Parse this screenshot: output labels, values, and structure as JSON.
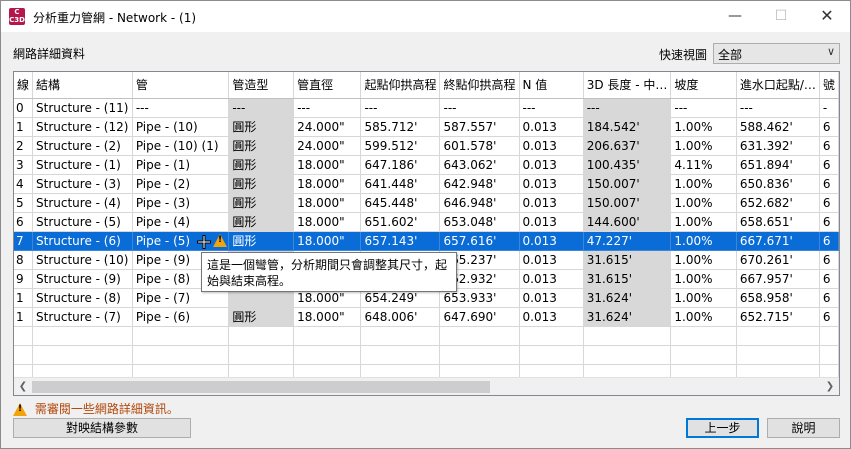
{
  "window": {
    "title": "分析重力管網 - Network - (1)",
    "icon_text_top": "C",
    "icon_text_bottom": "C3D",
    "minimize_icon": "minimize-icon",
    "maximize_icon": "maximize-icon",
    "close_icon": "close-icon"
  },
  "section": {
    "label": "網路詳細資料",
    "quick_view_label": "快速視圖",
    "quick_view_value": "全部"
  },
  "table": {
    "columns": [
      "線",
      "結構",
      "管",
      "管造型",
      "管直徑",
      "起點仰拱高程",
      "終點仰拱高程",
      "N 值",
      "3D 長度 - 中…",
      "坡度",
      "進水口起點/…",
      "號"
    ],
    "rows": [
      [
        "0",
        "Structure - (11)",
        "---",
        "---",
        "---",
        "---",
        "---",
        "---",
        "---",
        "---",
        "---",
        "-"
      ],
      [
        "1",
        "Structure - (12)",
        "Pipe - (10)",
        "圓形",
        "24.000\"",
        "585.712'",
        "587.557'",
        "0.013",
        "184.542'",
        "1.00%",
        "588.462'",
        "6"
      ],
      [
        "2",
        "Structure - (2)",
        "Pipe - (10) (1)",
        "圓形",
        "24.000\"",
        "599.512'",
        "601.578'",
        "0.013",
        "206.637'",
        "1.00%",
        "631.392'",
        "6"
      ],
      [
        "3",
        "Structure - (1)",
        "Pipe - (1)",
        "圓形",
        "18.000\"",
        "647.186'",
        "643.062'",
        "0.013",
        "100.435'",
        "4.11%",
        "651.894'",
        "6"
      ],
      [
        "4",
        "Structure - (3)",
        "Pipe - (2)",
        "圓形",
        "18.000\"",
        "641.448'",
        "642.948'",
        "0.013",
        "150.007'",
        "1.00%",
        "650.836'",
        "6"
      ],
      [
        "5",
        "Structure - (4)",
        "Pipe - (3)",
        "圓形",
        "18.000\"",
        "645.448'",
        "646.948'",
        "0.013",
        "150.007'",
        "1.00%",
        "652.682'",
        "6"
      ],
      [
        "6",
        "Structure - (5)",
        "Pipe - (4)",
        "圓形",
        "18.000\"",
        "651.602'",
        "653.048'",
        "0.013",
        "144.600'",
        "1.00%",
        "658.651'",
        "6"
      ],
      [
        "7",
        "Structure - (6)",
        "Pipe - (5)",
        "圓形",
        "18.000\"",
        "657.143'",
        "657.616'",
        "0.013",
        "47.227'",
        "1.00%",
        "667.671'",
        "6"
      ],
      [
        "8",
        "Structure - (10)",
        "Pipe - (9)",
        "",
        "",
        "",
        "665.237'",
        "0.013",
        "31.615'",
        "1.00%",
        "670.261'",
        "6"
      ],
      [
        "9",
        "Structure - (9)",
        "Pipe - (8)",
        "",
        "",
        "",
        "662.932'",
        "0.013",
        "31.615'",
        "1.00%",
        "667.957'",
        "6"
      ],
      [
        "1",
        "Structure - (8)",
        "Pipe - (7)",
        "",
        "18.000\"",
        "654.249'",
        "653.933'",
        "0.013",
        "31.624'",
        "1.00%",
        "658.958'",
        "6"
      ],
      [
        "1",
        "Structure - (7)",
        "Pipe - (6)",
        "圓形",
        "18.000\"",
        "648.006'",
        "647.690'",
        "0.013",
        "31.624'",
        "1.00%",
        "652.715'",
        "6"
      ]
    ],
    "selected_row": 7,
    "tooltip": "這是一個彎管，分析期間只會調整其尺寸，起始與結束高程。"
  },
  "status": {
    "message": "需審閱一些網路詳細資訊。"
  },
  "buttons": {
    "map_params": "對映結構參數",
    "back": "上一步",
    "help": "說明"
  },
  "colors": {
    "selection": "#0a6cd6",
    "warning": "#f0a30a",
    "status_text": "#b2470a",
    "gray_cell": "#d8d8d8"
  }
}
